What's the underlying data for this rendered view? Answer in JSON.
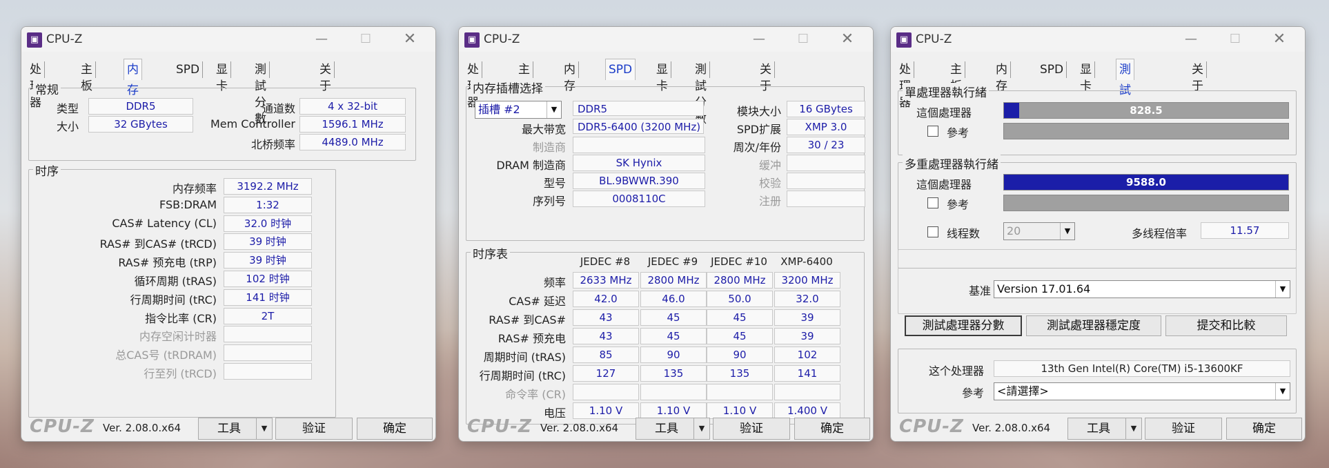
{
  "app": {
    "title": "CPU-Z",
    "brand": "CPU-Z",
    "version": "Ver. 2.08.0.x64",
    "tools_label": "工具",
    "validate_label": "验证",
    "ok_label": "确定"
  },
  "windows": [
    {
      "tabs": [
        "处理器",
        "主板",
        "内存",
        "SPD",
        "显卡",
        "測試分數",
        "关于"
      ],
      "active_tab": 2,
      "general": {
        "title": "常规",
        "type_label": "类型",
        "type_value": "DDR5",
        "size_label": "大小",
        "size_value": "32 GBytes",
        "channels_label": "通道数",
        "channels_value": "4 x 32-bit",
        "memctrl_label": "Mem Controller",
        "memctrl_value": "1596.1 MHz",
        "nb_label": "北桥频率",
        "nb_value": "4489.0 MHz"
      },
      "timings": {
        "title": "时序",
        "rows": [
          {
            "label": "内存频率",
            "value": "3192.2 MHz"
          },
          {
            "label": "FSB:DRAM",
            "value": "1:32"
          },
          {
            "label": "CAS# Latency (CL)",
            "value": "32.0 时钟"
          },
          {
            "label": "RAS# 到CAS# (tRCD)",
            "value": "39 时钟"
          },
          {
            "label": "RAS# 预充电 (tRP)",
            "value": "39 时钟"
          },
          {
            "label": "循环周期 (tRAS)",
            "value": "102 时钟"
          },
          {
            "label": "行周期时间 (tRC)",
            "value": "141 时钟"
          },
          {
            "label": "指令比率 (CR)",
            "value": "2T"
          },
          {
            "label": "内存空闲计时器",
            "value": ""
          },
          {
            "label": "总CAS号 (tRDRAM)",
            "value": ""
          },
          {
            "label": "行至列 (tRCD)",
            "value": ""
          }
        ]
      }
    },
    {
      "tabs": [
        "处理器",
        "主板",
        "内存",
        "SPD",
        "显卡",
        "測試分數",
        "关于"
      ],
      "active_tab": 3,
      "slot": {
        "title": "内存插槽选择",
        "slot_value": "插槽 #2",
        "type_value": "DDR5",
        "module_size_label": "模块大小",
        "module_size_value": "16 GBytes",
        "max_bw_label": "最大带宽",
        "max_bw_value": "DDR5-6400 (3200 MHz)",
        "spd_ext_label": "SPD扩展",
        "spd_ext_value": "XMP 3.0",
        "manufacturer_label": "制造商",
        "manufacturer_value": "",
        "week_year_label": "周次/年份",
        "week_year_value": "30 / 23",
        "dram_mfr_label": "DRAM 制造商",
        "dram_mfr_value": "SK Hynix",
        "buffered_label": "缓冲",
        "buffered_value": "",
        "part_label": "型号",
        "part_value": "BL.9BWWR.390",
        "check_label": "校验",
        "check_value": "",
        "serial_label": "序列号",
        "serial_value": "0008110C",
        "registered_label": "注册",
        "registered_value": ""
      },
      "timing_table": {
        "title": "时序表",
        "columns": [
          "JEDEC #8",
          "JEDEC #9",
          "JEDEC #10",
          "XMP-6400"
        ],
        "rows": [
          {
            "label": "频率",
            "values": [
              "2633 MHz",
              "2800 MHz",
              "2800 MHz",
              "3200 MHz"
            ]
          },
          {
            "label": "CAS# 延迟",
            "values": [
              "42.0",
              "46.0",
              "50.0",
              "32.0"
            ]
          },
          {
            "label": "RAS# 到CAS#",
            "values": [
              "43",
              "45",
              "45",
              "39"
            ]
          },
          {
            "label": "RAS# 预充电",
            "values": [
              "43",
              "45",
              "45",
              "39"
            ]
          },
          {
            "label": "周期时间 (tRAS)",
            "values": [
              "85",
              "90",
              "90",
              "102"
            ]
          },
          {
            "label": "行周期时间 (tRC)",
            "values": [
              "127",
              "135",
              "135",
              "141"
            ]
          },
          {
            "label": "命令率 (CR)",
            "values": [
              "",
              "",
              "",
              ""
            ]
          },
          {
            "label": "电压",
            "values": [
              "1.10 V",
              "1.10 V",
              "1.10 V",
              "1.400 V"
            ]
          }
        ]
      }
    },
    {
      "tabs": [
        "处理器",
        "主板",
        "内存",
        "SPD",
        "显卡",
        "測試分數",
        "关于"
      ],
      "active_tab": 5,
      "single": {
        "title": "單處理器執行緒",
        "this_label": "這個處理器",
        "this_value": "828.5",
        "this_fraction": 0.053,
        "ref_label": "參考"
      },
      "multi": {
        "title": "多重處理器執行緒",
        "this_label": "這個處理器",
        "this_value": "9588.0",
        "this_fraction": 1.0,
        "ref_label": "參考",
        "threads_label": "线程数",
        "threads_value": "20",
        "ratio_label": "多线程倍率",
        "ratio_value": "11.57"
      },
      "baseline_label": "基准",
      "baseline_value": "Version 17.01.64",
      "buttons": [
        "測試處理器分數",
        "測試處理器穩定度",
        "提交和比較"
      ],
      "this_cpu_label": "这个处理器",
      "this_cpu_value": "13th Gen Intel(R) Core(TM) i5-13600KF",
      "ref_label": "參考",
      "ref_value": "<請選擇>"
    }
  ]
}
